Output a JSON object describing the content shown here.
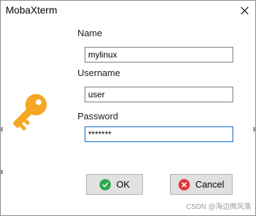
{
  "window": {
    "title": "MobaXterm"
  },
  "form": {
    "name_label": "Name",
    "name_value": "mylinux",
    "username_label": "Username",
    "username_value": "user",
    "password_label": "Password",
    "password_value": "*******"
  },
  "buttons": {
    "ok_label": "OK",
    "cancel_label": "Cancel"
  },
  "icons": {
    "key": "key-icon",
    "close": "close-icon",
    "ok": "check-circle-icon",
    "cancel": "x-circle-icon"
  },
  "colors": {
    "key": "#f5a623",
    "ok_icon": "#2fa84f",
    "cancel_icon": "#e0373d",
    "focus_border": "#0a64c8"
  },
  "watermark": "CSDN @海边微风落"
}
